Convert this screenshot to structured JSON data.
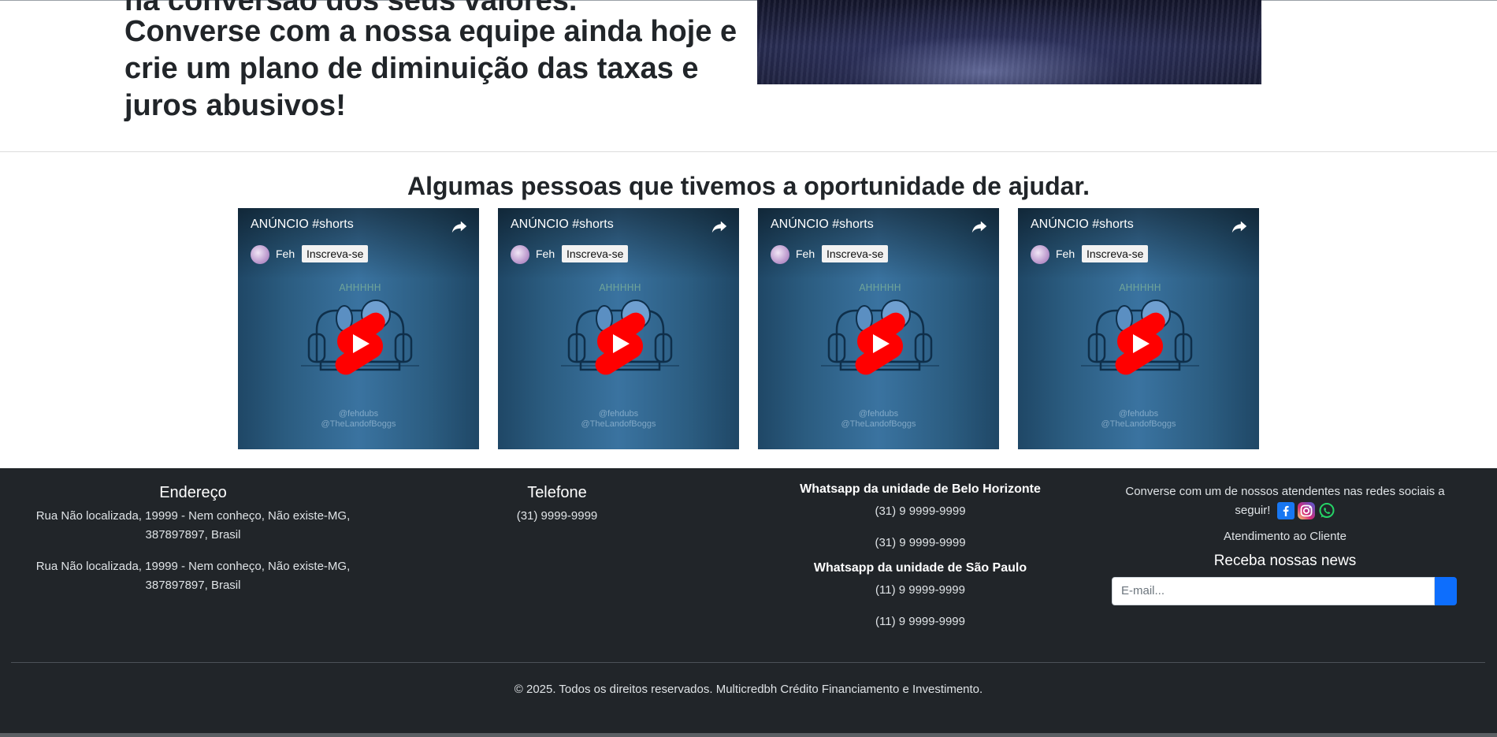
{
  "hero": {
    "line_cut": "na conversão dos seus valores.",
    "paragraph": "Converse com a nossa equipe ainda hoje e crie um plano de diminuição das taxas e juros abusivos!"
  },
  "testimonials": {
    "title": "Algumas pessoas que tivemos a oportunidade de ajudar.",
    "videos": [
      {
        "title": "ANÚNCIO #shorts",
        "channel": "Feh",
        "subscribe": "Inscreva-se",
        "credit1": "@fehdubs",
        "credit2": "@TheLandofBoggs"
      },
      {
        "title": "ANÚNCIO #shorts",
        "channel": "Feh",
        "subscribe": "Inscreva-se",
        "credit1": "@fehdubs",
        "credit2": "@TheLandofBoggs"
      },
      {
        "title": "ANÚNCIO #shorts",
        "channel": "Feh",
        "subscribe": "Inscreva-se",
        "credit1": "@fehdubs",
        "credit2": "@TheLandofBoggs"
      },
      {
        "title": "ANÚNCIO #shorts",
        "channel": "Feh",
        "subscribe": "Inscreva-se",
        "credit1": "@fehdubs",
        "credit2": "@TheLandofBoggs"
      }
    ]
  },
  "footer": {
    "address": {
      "title": "Endereço",
      "lines": [
        "Rua Não localizada, 19999 - Nem conheço, Não existe-MG, 387897897, Brasil",
        "Rua Não localizada, 19999 - Nem conheço, Não existe-MG, 387897897, Brasil"
      ]
    },
    "phone": {
      "title": "Telefone",
      "number": "(31) 9999-9999"
    },
    "whatsapp": {
      "bh_title": "Whatsapp da unidade de Belo Horizonte",
      "bh_numbers": [
        "(31) 9 9999-9999",
        "(31) 9 9999-9999"
      ],
      "sp_title": "Whatsapp da unidade de São Paulo",
      "sp_numbers": [
        "(11) 9 9999-9999",
        "(11) 9 9999-9999"
      ]
    },
    "social": {
      "text": "Converse com um de nossos atendentes nas redes sociais a seguir!",
      "icons": [
        "facebook-icon",
        "instagram-icon",
        "whatsapp-icon"
      ],
      "support": "Atendimento ao Cliente"
    },
    "newsletter": {
      "title": "Receba nossas news",
      "placeholder": "E-mail..."
    },
    "copyright": "© 2025. Todos os direitos reservados. Multicredbh Crédito Financiamento e Investimento."
  },
  "colors": {
    "footer_bg": "#212529",
    "accent": "#0d6efd",
    "youtube_red": "#ff0000"
  }
}
